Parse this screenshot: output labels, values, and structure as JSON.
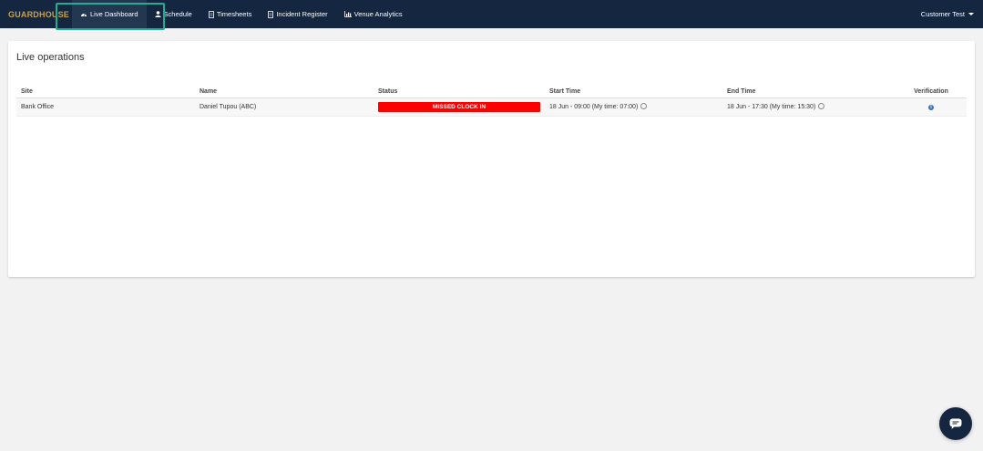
{
  "brand": {
    "name": "GUARDHOUSE"
  },
  "nav": {
    "items": [
      {
        "label": "Live Dashboard",
        "icon": "dashboard-icon",
        "active": true
      },
      {
        "label": "Schedule",
        "icon": "user-icon"
      },
      {
        "label": "Timesheets",
        "icon": "document-icon"
      },
      {
        "label": "Incident Register",
        "icon": "document-icon"
      },
      {
        "label": "Venue Analytics",
        "icon": "bar-chart-icon"
      }
    ],
    "user": "Customer Test"
  },
  "panel": {
    "title": "Live operations",
    "columns": [
      "Site",
      "Name",
      "Status",
      "Start Time",
      "End Time",
      "Verification"
    ],
    "rows": [
      {
        "site": "Bank Office",
        "name": "Daniel Tupou (ABC)",
        "status": "MISSED CLOCK IN",
        "start": "18 Jun - 09:00 (My time: 07:00)",
        "end": "18 Jun - 17:30 (My time: 15:30)"
      }
    ]
  },
  "colors": {
    "navbar": "#142640",
    "brand": "#c9a24a",
    "highlight": "#1fae94",
    "status_missed": "#ff0000",
    "info": "#3a73b7"
  }
}
